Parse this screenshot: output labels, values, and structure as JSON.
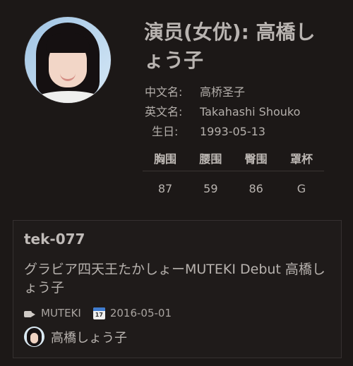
{
  "profile": {
    "title": "演员(女优): 高橋しょう子",
    "chinese_name_label": "中文名:",
    "chinese_name": "高桥圣子",
    "english_name_label": "英文名:",
    "english_name": "Takahashi Shouko",
    "birthday_label": "生日:",
    "birthday": "1993-05-13",
    "measurements": {
      "headers": [
        "胸围",
        "腰围",
        "臀围",
        "罩杯"
      ],
      "values": [
        "87",
        "59",
        "86",
        "G"
      ]
    }
  },
  "card": {
    "code": "tek-077",
    "title": "グラビア四天王たかしょーMUTEKI Debut 高橋しょう子",
    "studio": "MUTEKI",
    "date": "2016-05-01",
    "actress": "高橋しょう子"
  },
  "icons": {
    "camera": "camera-icon",
    "calendar": "calendar-icon"
  }
}
